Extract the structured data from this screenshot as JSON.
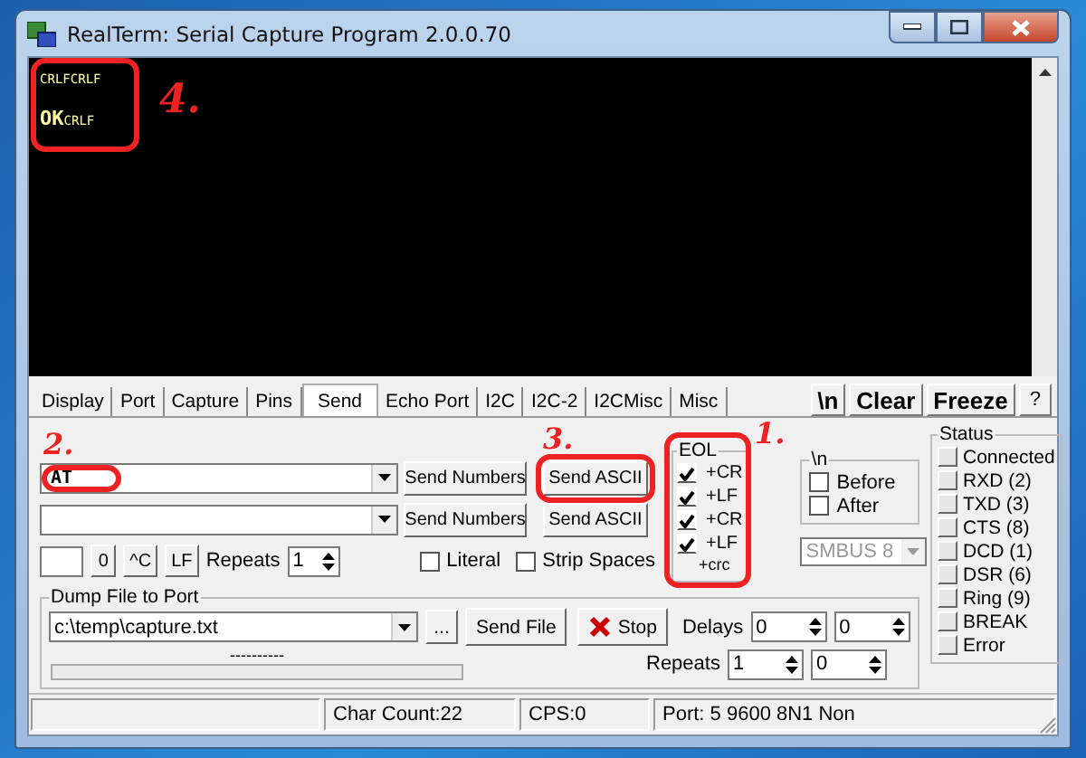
{
  "window": {
    "title": "RealTerm: Serial Capture Program 2.0.0.70"
  },
  "terminal": {
    "annotation": "4.",
    "lines": [
      [
        {
          "kind": "ctrl",
          "text": "CR"
        },
        {
          "kind": "ctrl",
          "text": "LF"
        },
        {
          "kind": "ctrl",
          "text": "CR"
        },
        {
          "kind": "ctrl",
          "text": "LF"
        }
      ],
      [
        {
          "kind": "char",
          "text": "OK"
        },
        {
          "kind": "ctrl",
          "text": "CR"
        },
        {
          "kind": "ctrl",
          "text": "LF"
        }
      ]
    ]
  },
  "tabs": [
    {
      "label": "Display",
      "selected": false
    },
    {
      "label": "Port",
      "selected": false
    },
    {
      "label": "Capture",
      "selected": false
    },
    {
      "label": "Pins",
      "selected": false
    },
    {
      "label": "Send",
      "selected": true
    },
    {
      "label": "Echo Port",
      "selected": false
    },
    {
      "label": "I2C",
      "selected": false
    },
    {
      "label": "I2C-2",
      "selected": false
    },
    {
      "label": "I2CMisc",
      "selected": false
    },
    {
      "label": "Misc",
      "selected": false
    }
  ],
  "tab_buttons": [
    "\\n",
    "Clear",
    "Freeze",
    "?"
  ],
  "send": {
    "rows": [
      {
        "value": "AT",
        "annotation": "2.",
        "numbers_button": "Send Numbers",
        "ascii_button": "Send ASCII",
        "ascii_annotation": "3."
      },
      {
        "numbers_button": "Send Numbers",
        "ascii_button": "Send ASCII"
      }
    ],
    "char_buttons": [
      "0",
      "^C",
      "LF"
    ],
    "repeats_label": "Repeats",
    "repeats": "1",
    "options": [
      {
        "label": "Literal",
        "checked": false
      },
      {
        "label": "Strip Spaces",
        "checked": false
      }
    ]
  },
  "eol": {
    "title": "EOL",
    "annotation": "1.",
    "items": [
      {
        "kind": "checkbox",
        "label": "+CR",
        "checked": true
      },
      {
        "kind": "checkbox",
        "label": "+LF",
        "checked": true
      },
      {
        "kind": "checkbox",
        "label": "+CR",
        "checked": true
      },
      {
        "kind": "checkbox",
        "label": "+LF",
        "checked": true
      },
      {
        "kind": "text",
        "label": "+crc"
      }
    ]
  },
  "newline_group": {
    "title": "\\n",
    "items": [
      {
        "label": "Before",
        "checked": false
      },
      {
        "label": "After",
        "checked": false
      }
    ]
  },
  "smbus_combo": {
    "value": "SMBUS 8",
    "disabled": true
  },
  "dump": {
    "title": "Dump File to Port",
    "file": "c:\\temp\\capture.txt",
    "browse_button": "...",
    "send_file_button": "Send File",
    "stop_button": "Stop",
    "delays_label": "Delays",
    "delays": [
      "0",
      "0"
    ],
    "repeats_label": "Repeats",
    "repeats": [
      "1",
      "0"
    ],
    "progress_text": "----------",
    "progress": {
      "level": 0
    }
  },
  "status": {
    "title": "Status",
    "items": [
      {
        "label": "Connected",
        "on": false
      },
      {
        "label": "RXD (2)",
        "on": false
      },
      {
        "label": "TXD (3)",
        "on": false
      },
      {
        "label": "CTS (8)",
        "on": false
      },
      {
        "label": "DCD (1)",
        "on": false
      },
      {
        "label": "DSR (6)",
        "on": false
      },
      {
        "label": "Ring (9)",
        "on": false
      },
      {
        "label": "BREAK",
        "on": false
      },
      {
        "label": "Error",
        "on": false
      }
    ]
  },
  "status_bar": [
    "Char Count:22",
    "CPS:0",
    "Port: 5 9600 8N1 Non"
  ]
}
